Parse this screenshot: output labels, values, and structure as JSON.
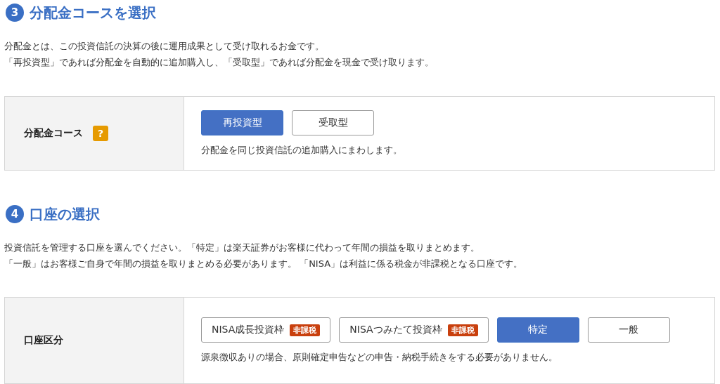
{
  "sections": [
    {
      "number": "3",
      "title": "分配金コースを選択",
      "description": [
        "分配金とは、この投資信託の決算の後に運用成果として受け取れるお金です。",
        "「再投資型」であれば分配金を自動的に追加購入し、「受取型」であれば分配金を現金で受け取ります。"
      ],
      "field": {
        "label": "分配金コース",
        "help": "?",
        "options": [
          {
            "label": "再投資型",
            "selected": true
          },
          {
            "label": "受取型",
            "selected": false
          }
        ],
        "note": "分配金を同じ投資信託の追加購入にまわします。"
      }
    },
    {
      "number": "4",
      "title": "口座の選択",
      "description": [
        "投資信託を管理する口座を選んでください。「特定」は楽天証券がお客様に代わって年間の損益を取りまとめます。",
        "「一般」はお客様ご自身で年間の損益を取りまとめる必要があります。 「NISA」は利益に係る税金が非課税となる口座です。"
      ],
      "field": {
        "label": "口座区分",
        "options": [
          {
            "label": "NISA成長投資枠",
            "badge": "非課税",
            "selected": false
          },
          {
            "label": "NISAつみたて投資枠",
            "badge": "非課税",
            "selected": false
          },
          {
            "label": "特定",
            "selected": true
          },
          {
            "label": "一般",
            "selected": false
          }
        ],
        "note": "源泉徴収ありの場合、原則確定申告などの申告・納税手続きをする必要がありません。"
      }
    }
  ]
}
